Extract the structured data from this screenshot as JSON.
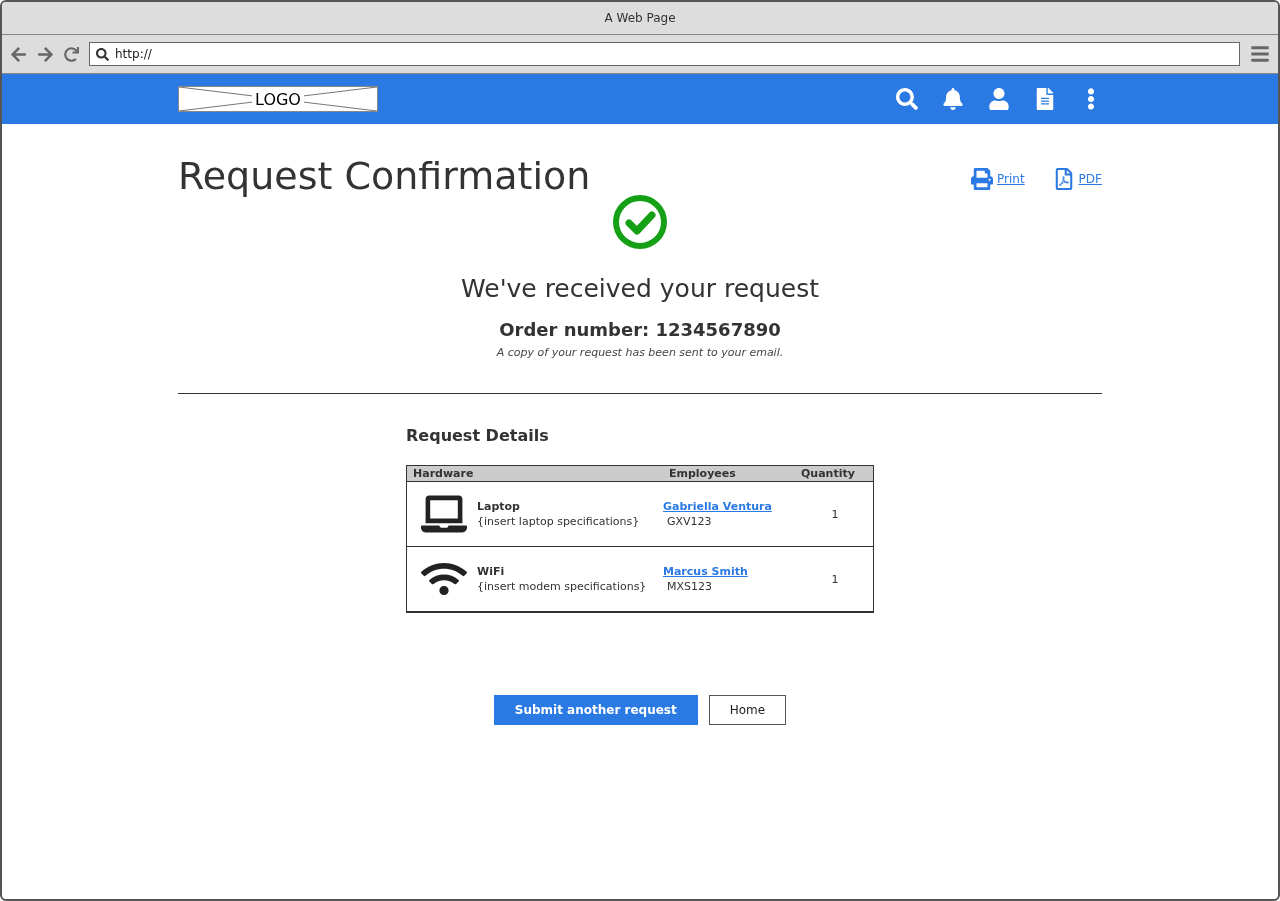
{
  "window": {
    "title": "A Web Page"
  },
  "address_bar": {
    "value": "http://"
  },
  "header": {
    "logo": "LOGO"
  },
  "page": {
    "title": "Request Confirmation",
    "actions": [
      {
        "kind": "print",
        "label": "Print"
      },
      {
        "kind": "pdf",
        "label": "PDF"
      }
    ],
    "confirmation": {
      "heading": "We've received your request",
      "order_number": "Order number: 1234567890",
      "note": "A copy of your request has been sent to your email."
    }
  },
  "details": {
    "title": "Request Details",
    "table": {
      "columns": [
        "Hardware",
        "Employees",
        "Quantity"
      ],
      "rows": [
        {
          "kind": "laptop",
          "name": "Laptop",
          "spec": "{insert laptop specifications}",
          "employee": "Gabriella Ventura",
          "employee_id": "GXV123",
          "quantity": "1"
        },
        {
          "kind": "wifi",
          "name": "WiFi",
          "spec": "{insert modem specifications}",
          "employee": "Marcus Smith",
          "employee_id": "MXS123",
          "quantity": "1"
        }
      ]
    }
  },
  "buttons": [
    {
      "kind": "primary",
      "label": "Submit another request"
    },
    {
      "kind": "secondary",
      "label": "Home"
    }
  ]
}
